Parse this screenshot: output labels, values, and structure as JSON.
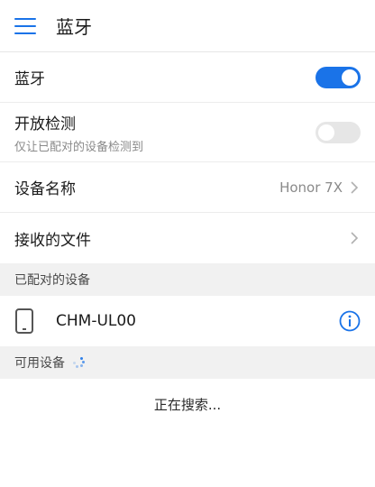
{
  "header": {
    "title": "蓝牙"
  },
  "bluetooth": {
    "label": "蓝牙",
    "enabled": true
  },
  "discoverable": {
    "label": "开放检测",
    "sublabel": "仅让已配对的设备检测到",
    "enabled": false
  },
  "device_name": {
    "label": "设备名称",
    "value": "Honor 7X"
  },
  "received_files": {
    "label": "接收的文件"
  },
  "paired": {
    "header": "已配对的设备",
    "devices": [
      {
        "name": "CHM-UL00"
      }
    ]
  },
  "available": {
    "header": "可用设备",
    "status": "正在搜索..."
  },
  "colors": {
    "accent": "#1a73e8",
    "section_bg": "#f1f1f1"
  }
}
